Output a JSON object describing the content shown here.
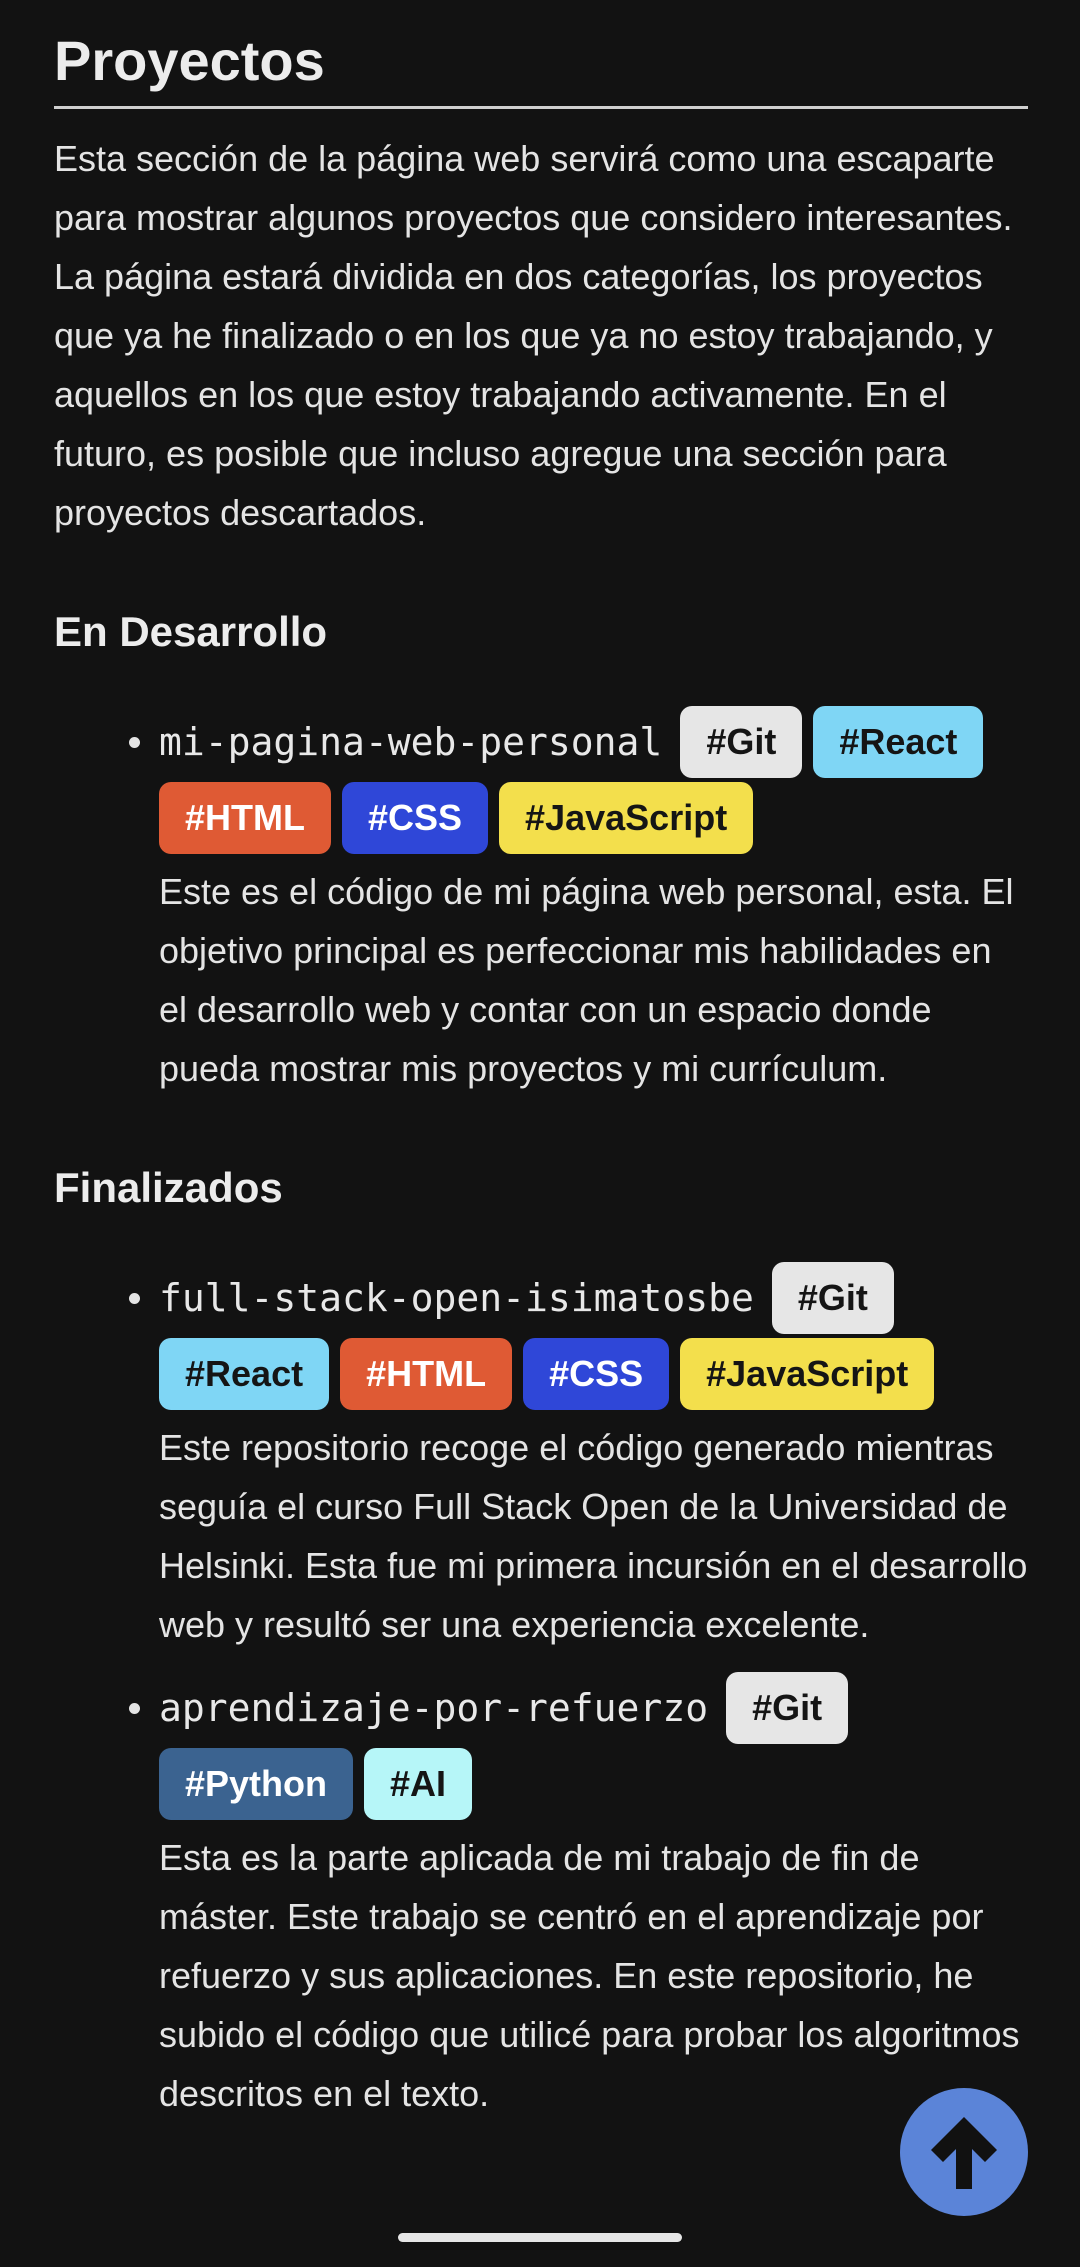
{
  "page": {
    "title": "Proyectos",
    "intro": "Esta sección de la página web servirá como una escaparte para mostrar algunos proyectos que considero interesantes. La página estará dividida en dos categorías, los proyectos que ya he finalizado o en los que ya no estoy trabajando, y aquellos en los que estoy trabajando activamente. En el futuro, es posible que incluso agregue una sección para proyectos descartados."
  },
  "tag_colors": {
    "Git": "#e6e6e6",
    "React": "#7fd6f5",
    "HTML": "#df5a34",
    "CSS": "#2f47d8",
    "JavaScript": "#f3df4c",
    "Python": "#3b6390",
    "AI": "#b6f6f8"
  },
  "sections": [
    {
      "heading": "En Desarrollo",
      "projects": [
        {
          "name": "mi-pagina-web-personal",
          "tags": [
            "#Git",
            "#React",
            "#HTML",
            "#CSS",
            "#JavaScript"
          ],
          "description": "Este es el código de mi página web personal, esta. El objetivo principal es perfeccionar mis habilidades en el desarrollo web y contar con un espacio donde pueda mostrar mis proyectos y mi currículum."
        }
      ]
    },
    {
      "heading": "Finalizados",
      "projects": [
        {
          "name": "full-stack-open-isimatosbe",
          "tags": [
            "#Git",
            "#React",
            "#HTML",
            "#CSS",
            "#JavaScript"
          ],
          "description": "Este repositorio recoge el código generado mientras seguía el curso Full Stack Open de la Universidad de Helsinki. Esta fue mi primera incursión en el desarrollo web y resultó ser una experiencia excelente."
        },
        {
          "name": "aprendizaje-por-refuerzo",
          "tags": [
            "#Git",
            "#Python",
            "#AI"
          ],
          "description": "Esta es la parte aplicada de mi trabajo de fin de máster. Este trabajo se centró en el aprendizaje por refuerzo y sus aplicaciones. En este repositorio, he subido el código que utilicé para probar los algoritmos descritos en el texto."
        }
      ]
    }
  ],
  "scroll_top": {
    "icon": "arrow-up-icon",
    "color": "#5b84d8"
  }
}
